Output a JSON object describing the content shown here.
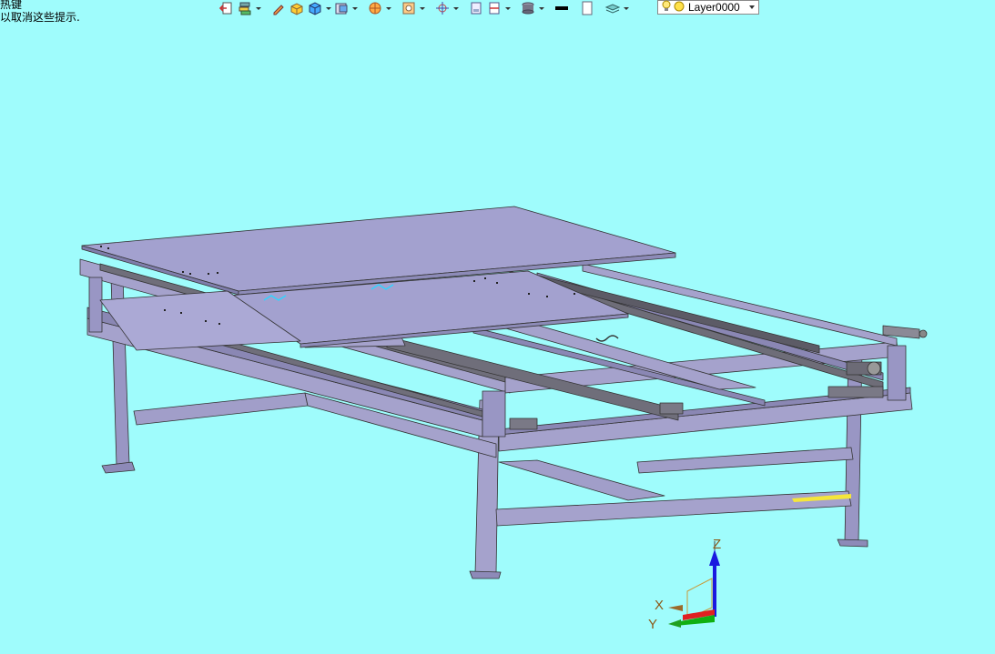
{
  "hints": {
    "line1": "热键",
    "line2": "以取消这些提示."
  },
  "toolbar": {
    "icons": [
      "exit-icon",
      "layers-stack-icon",
      "pen-icon",
      "box-yellow-icon",
      "cube-icon",
      "view-cube-icon",
      "render-sphere-icon",
      "section-icon",
      "origin-icon",
      "view-frame-icon",
      "view-dim-icon",
      "display-mode-icon",
      "color-swatch-icon",
      "blank-page-icon",
      "layer-manager-icon"
    ]
  },
  "layer": {
    "name": "Layer0000"
  },
  "triad": {
    "x_label": "X",
    "y_label": "Y",
    "z_label": "Z"
  },
  "colors": {
    "background": "#9ffcfc",
    "frame": "#a5a2cc",
    "frame_dark": "#7c79a6",
    "rail": "#8a8a92"
  }
}
